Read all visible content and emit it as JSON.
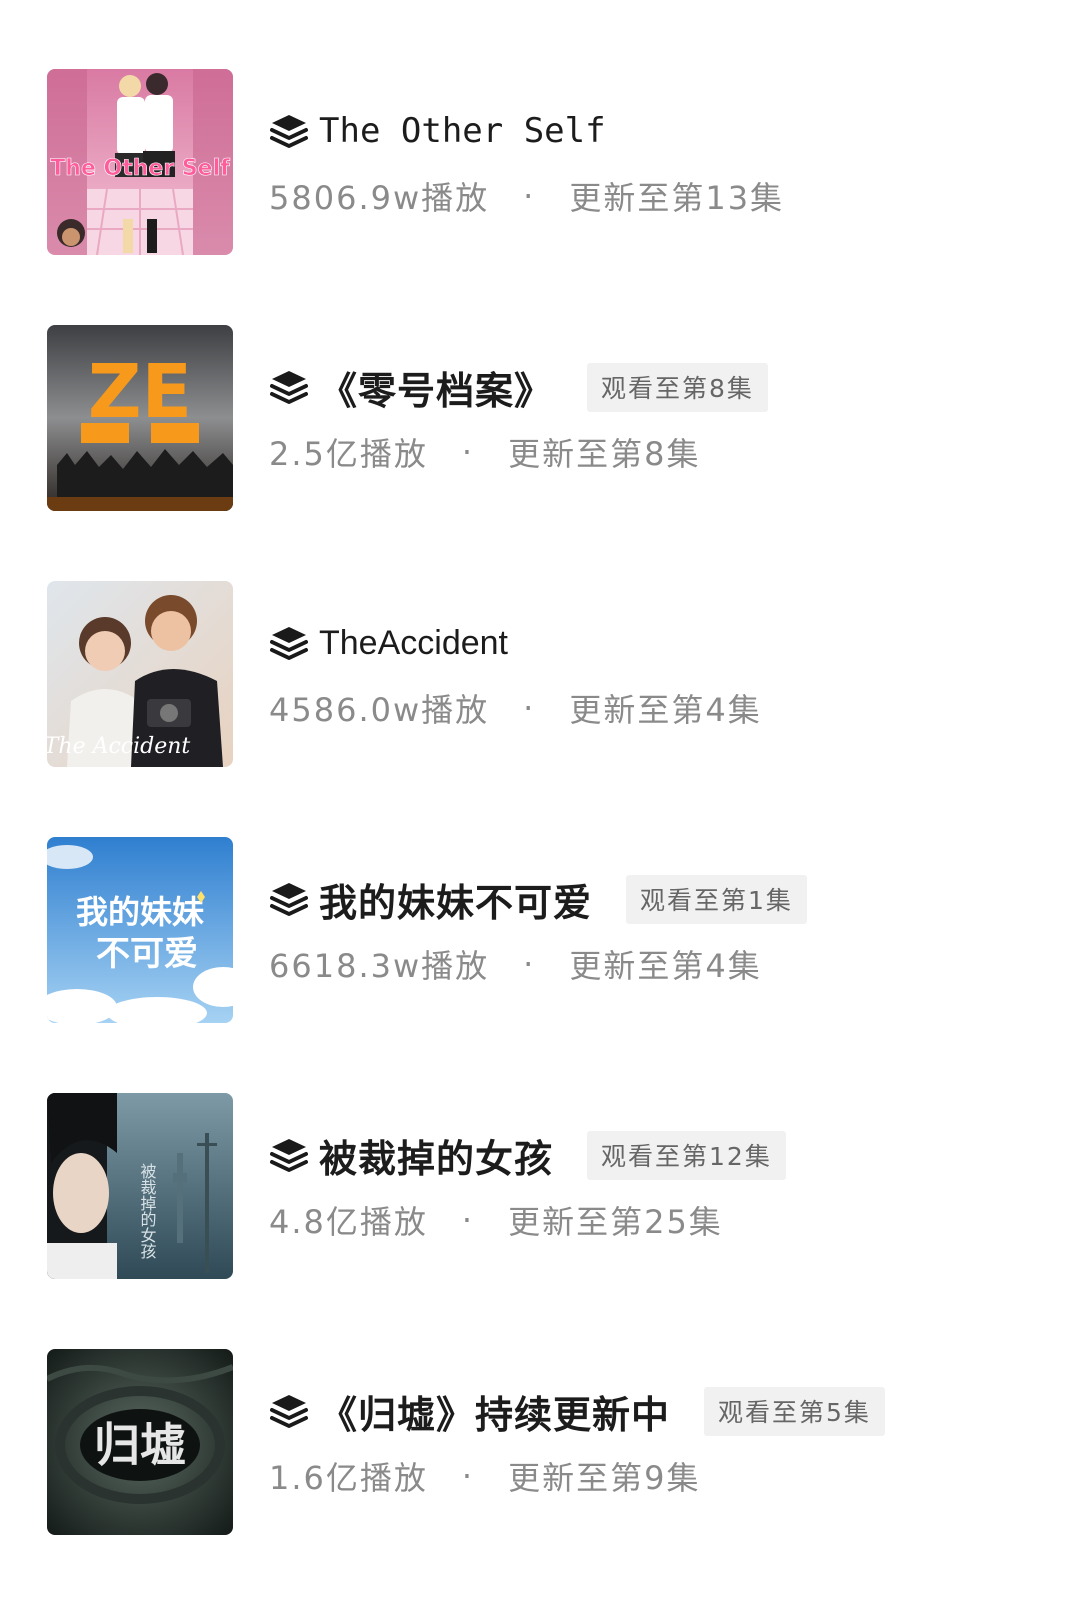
{
  "items": [
    {
      "title": "The Other Self",
      "title_latin": true,
      "badge": "",
      "plays": "5806.9w播放",
      "separator": "·",
      "update": "更新至第13集",
      "cover": {
        "name": "the-other-self-cover",
        "text": "The Other Self",
        "bg": "#e79ab6",
        "bg2": "#f2bdd0",
        "accent": "#f06aa0"
      }
    },
    {
      "title": "《零号档案》",
      "title_latin": false,
      "badge": "观看至第8集",
      "plays": "2.5亿播放",
      "separator": "·",
      "update": "更新至第8集",
      "cover": {
        "name": "zero-cover",
        "text": "ZE",
        "bg": "#4c4d50",
        "bg2": "#9a9a9c",
        "accent": "#f79a1c"
      }
    },
    {
      "title": "TheAccident",
      "title_latin": true,
      "badge": "",
      "plays": "4586.0w播放",
      "separator": "·",
      "update": "更新至第4集",
      "cover": {
        "name": "the-accident-cover",
        "text": "The Accident",
        "bg": "#cfd6dc",
        "bg2": "#e9d9cc",
        "accent": "#2a2a2e"
      }
    },
    {
      "title": "我的妹妹不可爱",
      "title_latin": false,
      "badge": "观看至第1集",
      "plays": "6618.3w播放",
      "separator": "·",
      "update": "更新至第4集",
      "cover": {
        "name": "my-sister-cover",
        "text": "我的妹妹不可爱",
        "bg": "#3c8ad6",
        "bg2": "#9ccaf0",
        "accent": "#ffffff"
      }
    },
    {
      "title": "被裁掉的女孩",
      "title_latin": false,
      "badge": "观看至第12集",
      "plays": "4.8亿播放",
      "separator": "·",
      "update": "更新至第25集",
      "cover": {
        "name": "laid-off-girl-cover",
        "text": "被裁掉的女孩",
        "bg": "#3f5e6c",
        "bg2": "#8ea6ae",
        "accent": "#d8d8d8"
      }
    },
    {
      "title": "《归墟》持续更新中",
      "title_latin": false,
      "badge": "观看至第5集",
      "plays": "1.6亿播放",
      "separator": "·",
      "update": "更新至第9集",
      "cover": {
        "name": "gui-xu-cover",
        "text": "归墟",
        "bg": "#1f2a26",
        "bg2": "#4b5a52",
        "accent": "#e6e6e6"
      }
    }
  ]
}
